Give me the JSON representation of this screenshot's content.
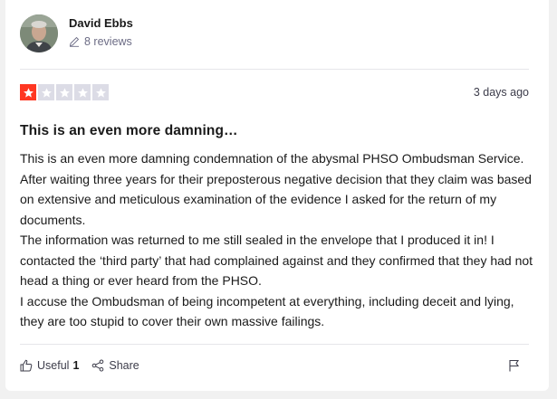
{
  "author": {
    "name": "David Ebbs",
    "reviews": "8 reviews"
  },
  "rating": {
    "stars": 1,
    "max": 5,
    "filled_color": "#ff3722",
    "empty_color": "#dcdce6"
  },
  "date": "3 days ago",
  "review": {
    "title": "This is an even more damning…",
    "paragraphs": [
      "This is an even more damning condemnation of the abysmal PHSO Ombudsman Service. After waiting three years for their preposterous negative decision that they claim was based on extensive and meticulous examination of the evidence I asked for the return of my documents.",
      "The information was returned to me still sealed in the envelope that I produced it in! I contacted the ‘third party’ that had complained against and they confirmed that they had not head a thing or ever heard from the PHSO.",
      "I accuse the Ombudsman of being incompetent at everything, including deceit and lying, they are too stupid to cover their own massive failings."
    ]
  },
  "actions": {
    "useful_label": "Useful",
    "useful_count": "1",
    "share_label": "Share"
  },
  "icons": {
    "avatar": "avatar-photo",
    "reviews": "pencil-icon",
    "useful": "thumbs-up-icon",
    "share": "share-icon",
    "flag": "flag-icon"
  }
}
